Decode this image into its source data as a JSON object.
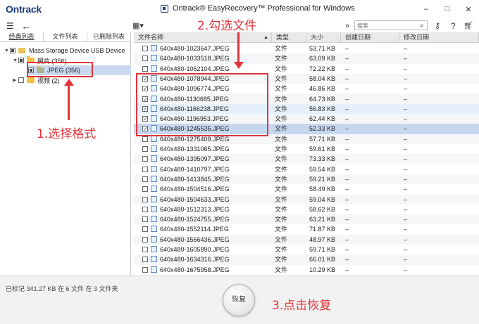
{
  "window": {
    "brand": "Ontrack",
    "title": "Ontrack® EasyRecovery™ Professional for Windows",
    "minimize_label": "–",
    "restore_label": "□",
    "close_label": "✕"
  },
  "toolbar": {
    "menu_icon": "hamburger-menu-icon",
    "back_icon": "back-arrow-icon",
    "view_icon": "grid-view-icon",
    "forward_icon": "double-chevron-right-icon",
    "search_placeholder": "搜索",
    "search_icon": "search-icon",
    "key_icon": "key-icon",
    "help_label": "?",
    "cart_icon": "cart-icon"
  },
  "left_panel": {
    "tabs": [
      "经典列表",
      "文件列表",
      "已删除列表"
    ],
    "active_tab": 0,
    "tree": [
      {
        "label": "Mass Storage Device USB Device",
        "level": 0,
        "expanded": true,
        "check": "partial",
        "icon": "drive-icon"
      },
      {
        "label": "照片 (356)",
        "level": 1,
        "expanded": true,
        "check": "partial",
        "icon": "folder-icon"
      },
      {
        "label": "JPEG (356)",
        "level": 2,
        "expanded": false,
        "check": "partial",
        "icon": "folder-icon",
        "selected": true
      },
      {
        "label": "视频 (2)",
        "level": 1,
        "expanded": false,
        "check": "none",
        "icon": "folder-icon"
      }
    ]
  },
  "table": {
    "columns": [
      "文件名称",
      "类型",
      "大小",
      "创建日期",
      "修改日期"
    ],
    "sort_indicator": "▲",
    "rows": [
      {
        "name": "640x480-1023647.JPEG",
        "type": "文件",
        "size": "53.71 KB",
        "created": "–",
        "modified": "–",
        "checked": false
      },
      {
        "name": "640x480-1033518.JPEG",
        "type": "文件",
        "size": "63.09 KB",
        "created": "–",
        "modified": "–",
        "checked": false
      },
      {
        "name": "640x480-1062104.JPEG",
        "type": "文件",
        "size": "72.22 KB",
        "created": "–",
        "modified": "–",
        "checked": false
      },
      {
        "name": "640x480-1078944.JPEG",
        "type": "文件",
        "size": "58.04 KB",
        "created": "–",
        "modified": "–",
        "checked": true
      },
      {
        "name": "640x480-1096774.JPEG",
        "type": "文件",
        "size": "46.86 KB",
        "created": "–",
        "modified": "–",
        "checked": true
      },
      {
        "name": "640x480-1130685.JPEG",
        "type": "文件",
        "size": "64.73 KB",
        "created": "–",
        "modified": "–",
        "checked": true
      },
      {
        "name": "640x480-1166238.JPEG",
        "type": "文件",
        "size": "56.83 KB",
        "created": "–",
        "modified": "–",
        "checked": true
      },
      {
        "name": "640x480-1196953.JPEG",
        "type": "文件",
        "size": "62.44 KB",
        "created": "–",
        "modified": "–",
        "checked": true
      },
      {
        "name": "640x480-1245535.JPEG",
        "type": "文件",
        "size": "52.33 KB",
        "created": "–",
        "modified": "–",
        "checked": true
      },
      {
        "name": "640x480-1275409.JPEG",
        "type": "文件",
        "size": "57.71 KB",
        "created": "–",
        "modified": "–",
        "checked": false
      },
      {
        "name": "640x480-1331065.JPEG",
        "type": "文件",
        "size": "59.61 KB",
        "created": "–",
        "modified": "–",
        "checked": false
      },
      {
        "name": "640x480-1395097.JPEG",
        "type": "文件",
        "size": "73.33 KB",
        "created": "–",
        "modified": "–",
        "checked": false
      },
      {
        "name": "640x480-1410797.JPEG",
        "type": "文件",
        "size": "59.54 KB",
        "created": "–",
        "modified": "–",
        "checked": false
      },
      {
        "name": "640x480-1413845.JPEG",
        "type": "文件",
        "size": "59.21 KB",
        "created": "–",
        "modified": "–",
        "checked": false
      },
      {
        "name": "640x480-1504516.JPEG",
        "type": "文件",
        "size": "58.49 KB",
        "created": "–",
        "modified": "–",
        "checked": false
      },
      {
        "name": "640x480-1504633.JPEG",
        "type": "文件",
        "size": "59.04 KB",
        "created": "–",
        "modified": "–",
        "checked": false
      },
      {
        "name": "640x480-1512313.JPEG",
        "type": "文件",
        "size": "58.62 KB",
        "created": "–",
        "modified": "–",
        "checked": false
      },
      {
        "name": "640x480-1524755.JPEG",
        "type": "文件",
        "size": "63.21 KB",
        "created": "–",
        "modified": "–",
        "checked": false
      },
      {
        "name": "640x480-1552114.JPEG",
        "type": "文件",
        "size": "71.87 KB",
        "created": "–",
        "modified": "–",
        "checked": false
      },
      {
        "name": "640x480-1566436.JPEG",
        "type": "文件",
        "size": "48.97 KB",
        "created": "–",
        "modified": "–",
        "checked": false
      },
      {
        "name": "640x480-1605890.JPEG",
        "type": "文件",
        "size": "59.71 KB",
        "created": "–",
        "modified": "–",
        "checked": false
      },
      {
        "name": "640x480-1634316.JPEG",
        "type": "文件",
        "size": "66.01 KB",
        "created": "–",
        "modified": "–",
        "checked": false
      },
      {
        "name": "640x480-1675958.JPEG",
        "type": "文件",
        "size": "10.29 KB",
        "created": "–",
        "modified": "–",
        "checked": false
      }
    ]
  },
  "status": {
    "summary": "已标记 341.27 KB 在 6 文件 在 3 文件夹",
    "recover_label": "恢复"
  },
  "annotations": {
    "step1": "1.选择格式",
    "step2": "2.勾选文件",
    "step3": "3.点击恢复",
    "color": "#e0343b"
  },
  "colors": {
    "brand": "#1c3d7a",
    "selection": "#c7d8ee",
    "header": "#e9e9e9"
  }
}
